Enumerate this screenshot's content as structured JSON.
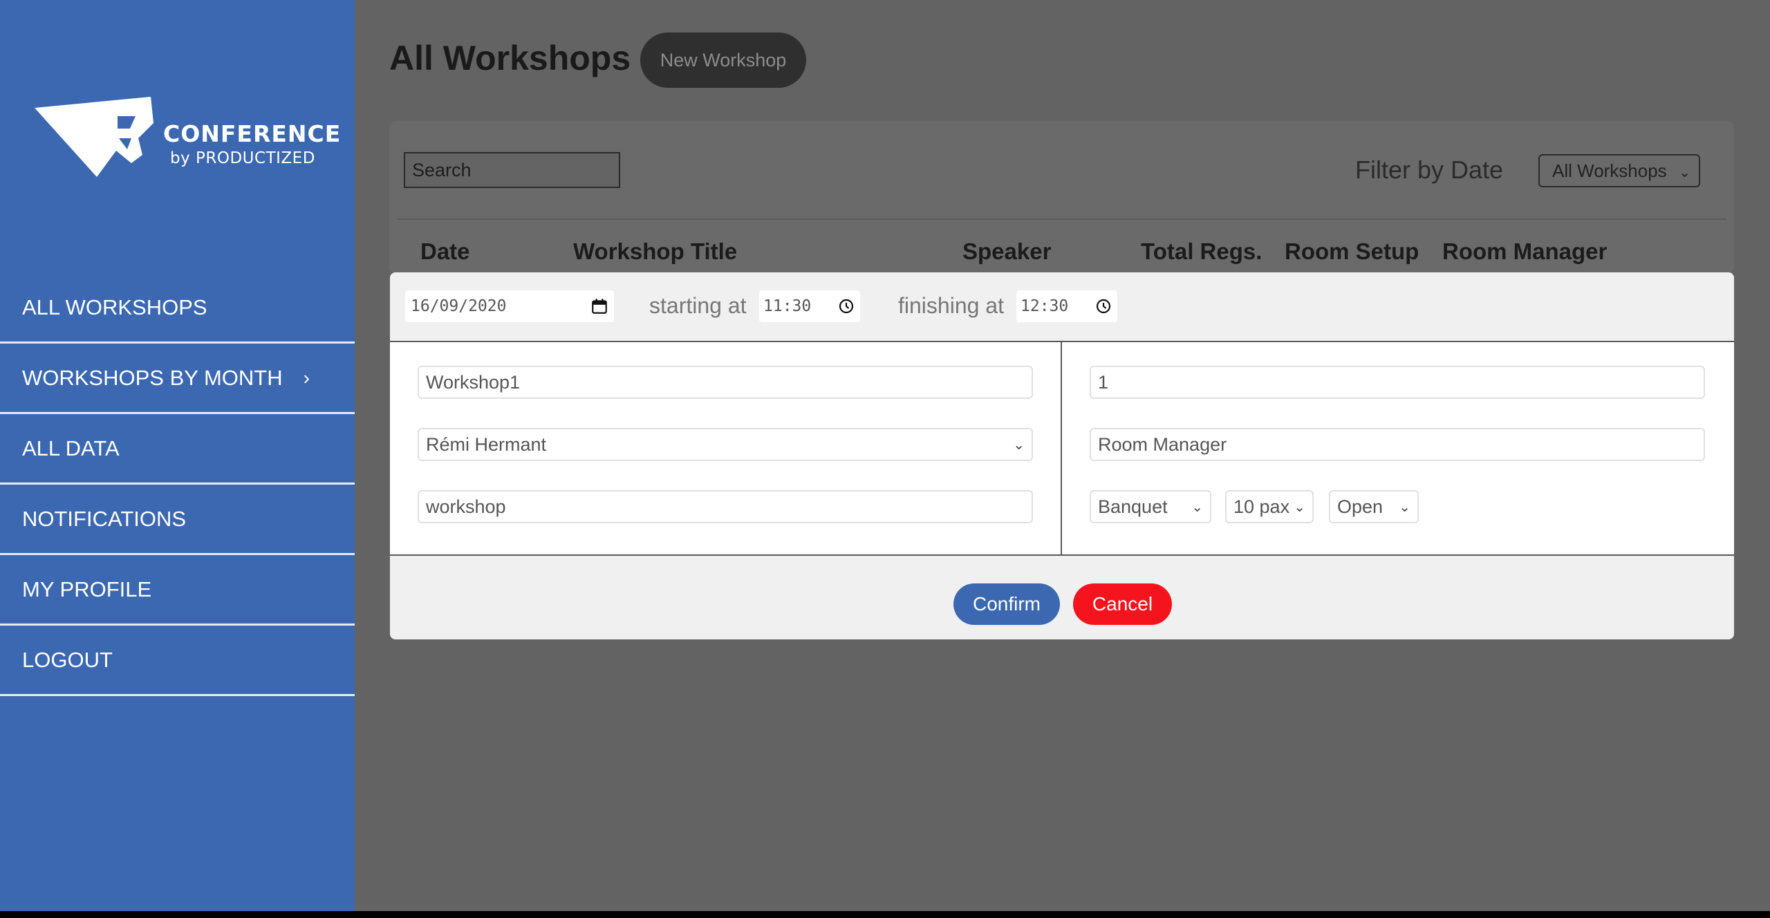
{
  "brand": {
    "name": "CONFERENCE",
    "sub": "by PRODUCTIZED",
    "color": "#3b68b0"
  },
  "sidebar": {
    "items": [
      {
        "label": "ALL WORKSHOPS"
      },
      {
        "label": "WORKSHOPS BY MONTH",
        "chevron": "›"
      },
      {
        "label": "ALL DATA"
      },
      {
        "label": "NOTIFICATIONS"
      },
      {
        "label": "MY PROFILE"
      },
      {
        "label": "LOGOUT"
      }
    ]
  },
  "header": {
    "title": "All Workshops",
    "new_button": "New Workshop"
  },
  "toolbar": {
    "search_value": "Search",
    "filter_label": "Filter by Date",
    "filter_value": "All Workshops"
  },
  "table": {
    "columns": [
      "Date",
      "Workshop Title",
      "Speaker",
      "Total Regs.",
      "Room Setup",
      "Room Manager"
    ]
  },
  "modal": {
    "date": "16/09/2020",
    "starting_label": "starting at",
    "start_time": "11:30",
    "finishing_label": "finishing at",
    "end_time": "12:30",
    "title_value": "Workshop1",
    "speaker_value": "Rémi Hermant",
    "type_value": "workshop",
    "number_value": "1",
    "room_manager_value": "Room Manager",
    "setup_value": "Banquet",
    "pax_value": "10 pax",
    "status_value": "Open",
    "confirm_label": "Confirm",
    "cancel_label": "Cancel",
    "confirm_color": "#3b68b0",
    "cancel_color": "#f5131d"
  }
}
